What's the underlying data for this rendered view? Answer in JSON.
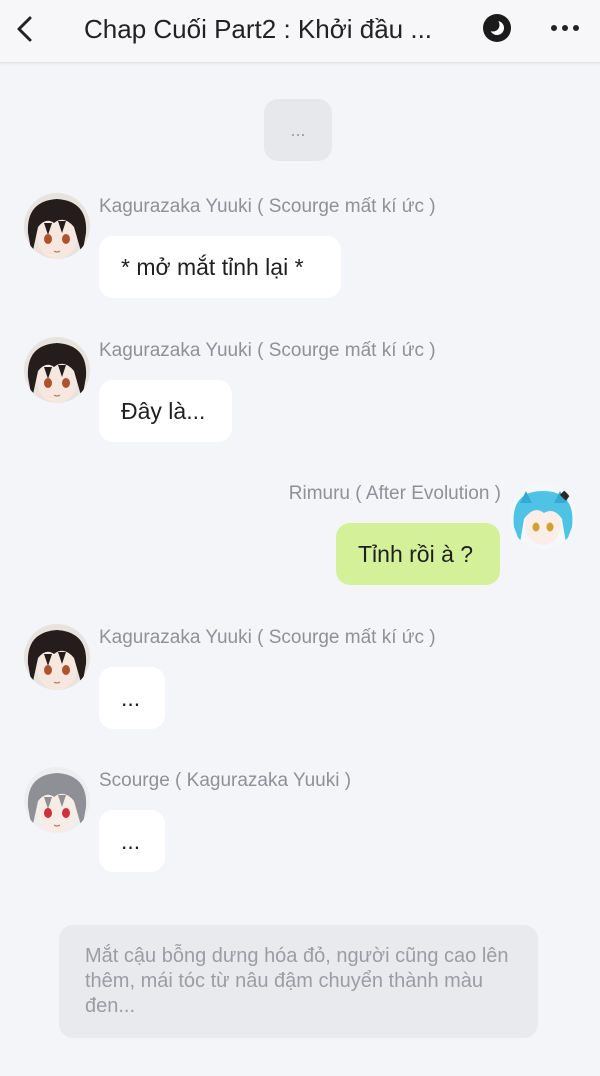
{
  "header": {
    "title": "Chap Cuối Part2 : Khởi đầu ...",
    "back_icon": "chevron-left-icon",
    "night_icon": "night-mode-icon",
    "more_icon": "more-horizontal-icon"
  },
  "system_message": "...",
  "messages": [
    {
      "sender": "Kagurazaka Yuuki ( Scourge mất kí ức )",
      "text": "* mở mắt tỉnh lại *",
      "side": "left"
    },
    {
      "sender": "Kagurazaka Yuuki ( Scourge mất kí ức )",
      "text": "Đây là...",
      "side": "left"
    },
    {
      "sender": "Rimuru ( After Evolution )",
      "text": "Tỉnh rồi à ?",
      "side": "right"
    },
    {
      "sender": "Kagurazaka Yuuki ( Scourge mất kí ức )",
      "text": "...",
      "side": "left"
    },
    {
      "sender": "Scourge ( Kagurazaka Yuuki )",
      "text": "...",
      "side": "left"
    }
  ],
  "narration": "Mắt cậu bỗng dưng hóa đỏ, người cũng cao lên thêm, mái tóc từ nâu đậm chuyển thành màu đen...",
  "colors": {
    "background": "#f4f5f8",
    "bubble": "#ffffff",
    "my_bubble": "#d4f19a",
    "narration_bg": "#e9eaed",
    "name_text": "#8f9196"
  }
}
